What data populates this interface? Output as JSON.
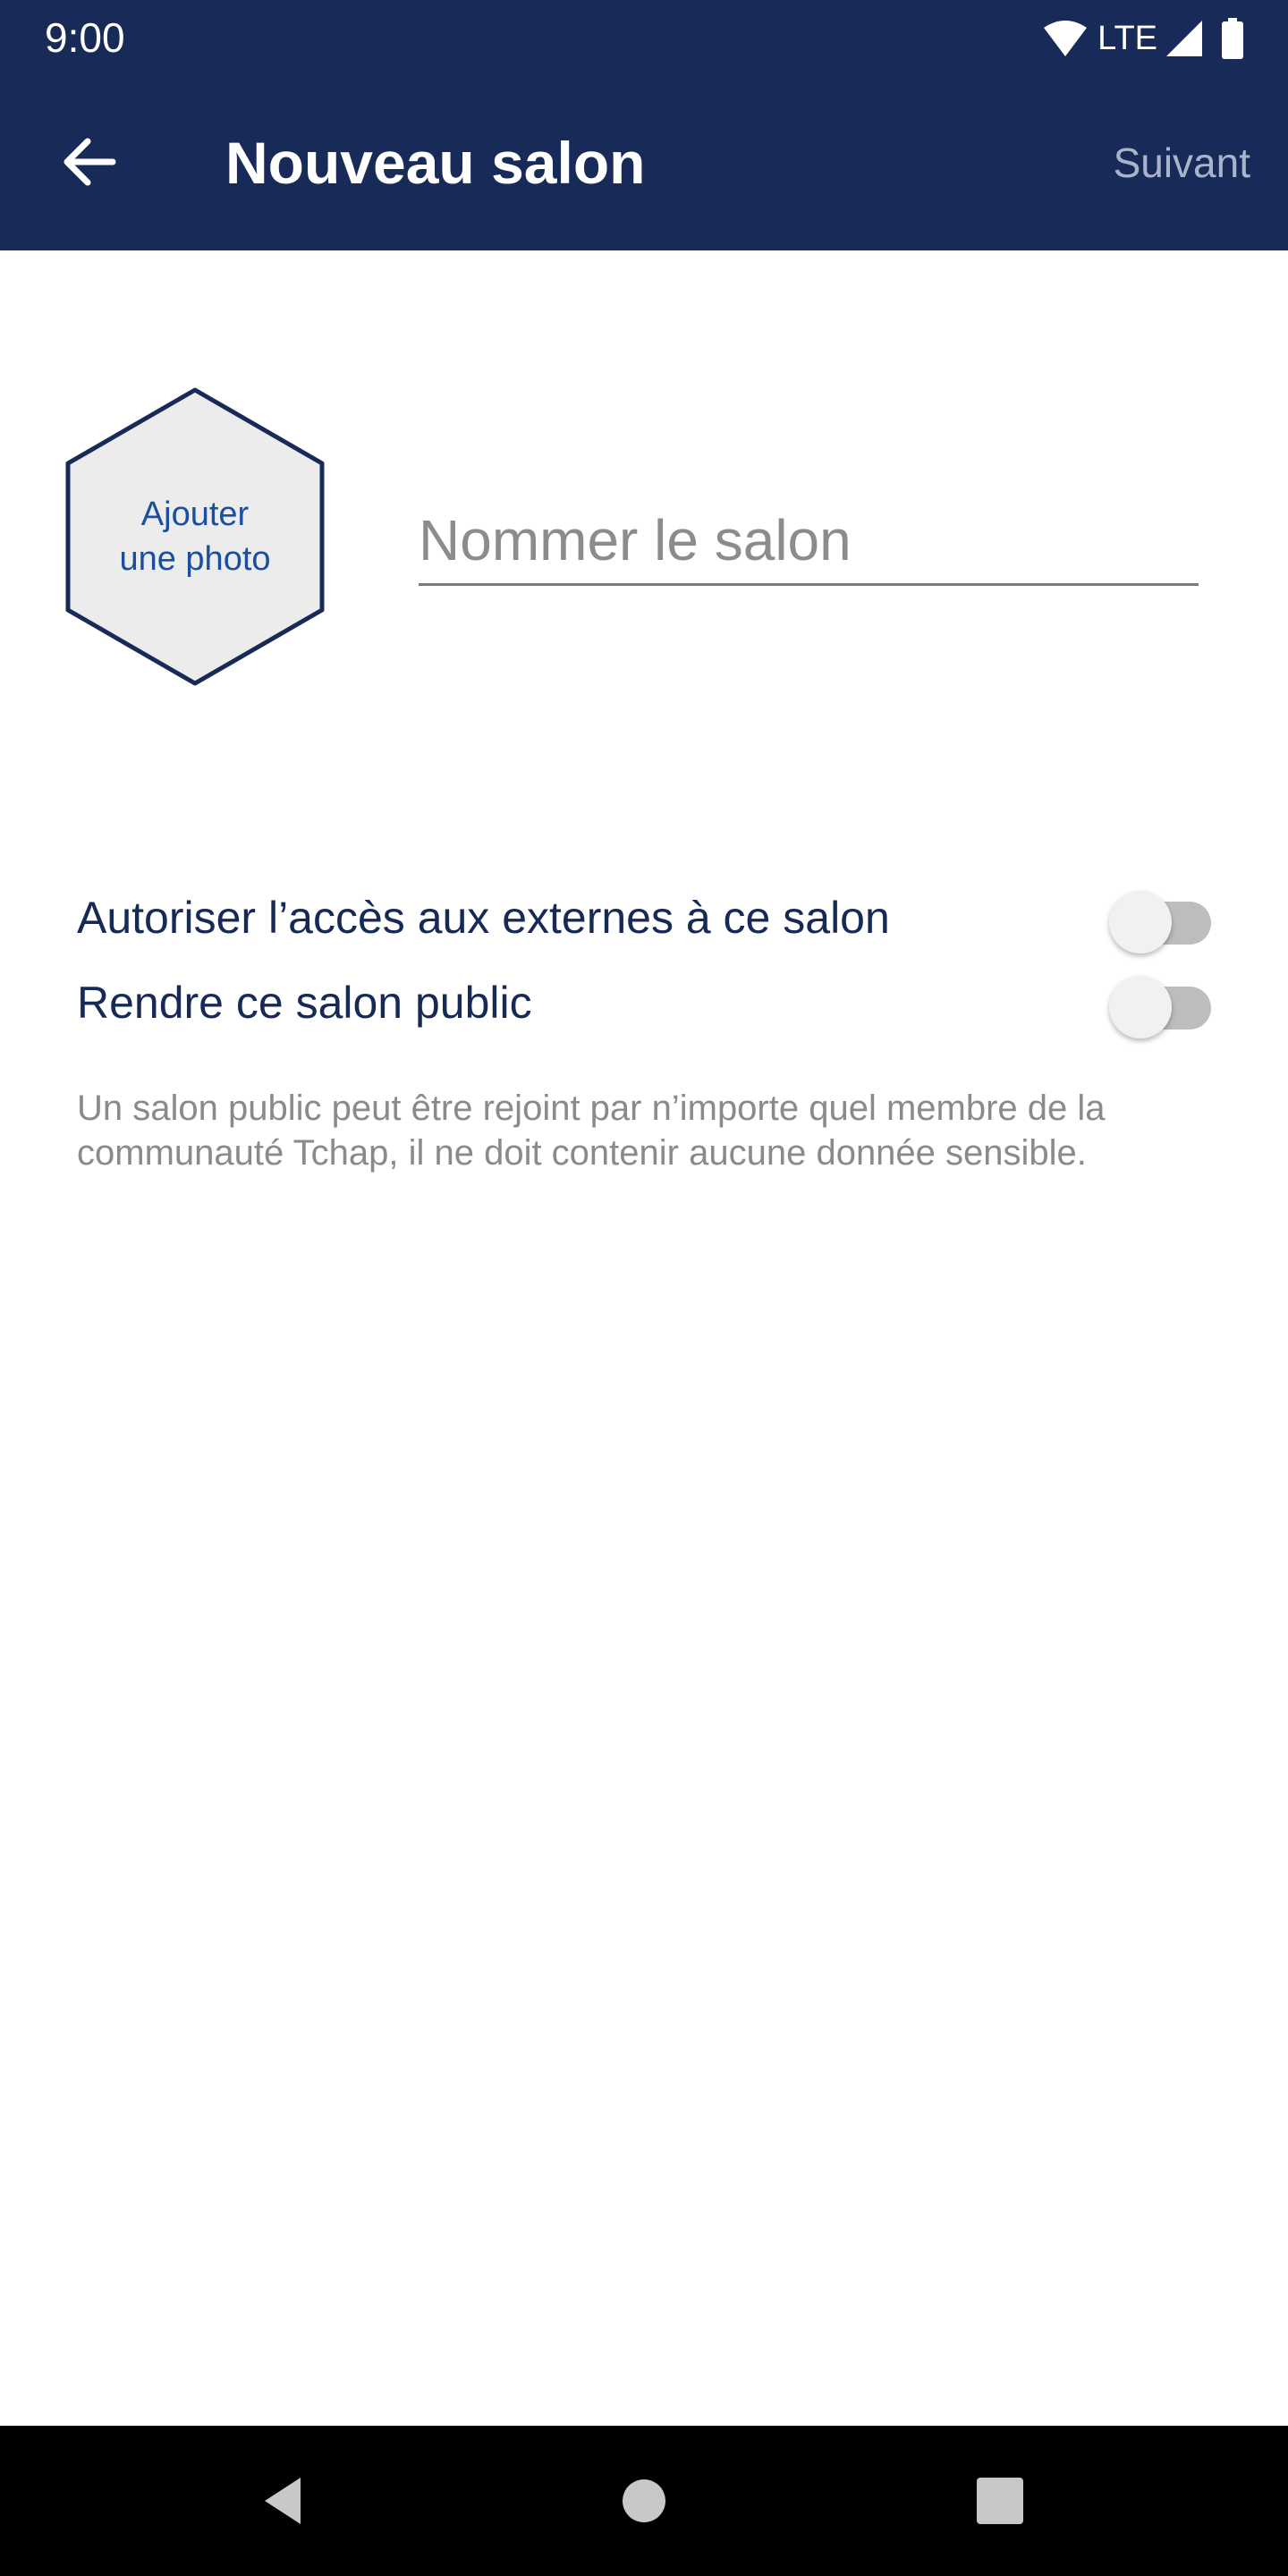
{
  "status_bar": {
    "time": "9:00",
    "network": "LTE",
    "icons": [
      "wifi-icon",
      "signal-icon",
      "battery-icon"
    ]
  },
  "app_bar": {
    "back_icon": "arrow-left-icon",
    "title": "Nouveau salon",
    "next_label": "Suivant"
  },
  "avatar": {
    "label_line1": "Ajouter",
    "label_line2": "une photo"
  },
  "name_input": {
    "placeholder": "Nommer le salon",
    "value": ""
  },
  "options": [
    {
      "label": "Autoriser l’accès aux externes à ce salon",
      "checked": false
    },
    {
      "label": "Rendre ce salon public",
      "checked": false
    }
  ],
  "help_text": "Un salon public peut être rejoint par n’importe quel membre de la communauté Tchap, il ne doit contenir aucune donnée sensible.",
  "nav_bar": {
    "icons": [
      "nav-back-icon",
      "nav-home-icon",
      "nav-recents-icon"
    ]
  },
  "colors": {
    "app_bar": "#182b58",
    "accent_text": "#162a55",
    "avatar_label": "#1a4fa0",
    "muted_text": "#8a8a8a",
    "switch_track_off": "#bdbdbd"
  }
}
